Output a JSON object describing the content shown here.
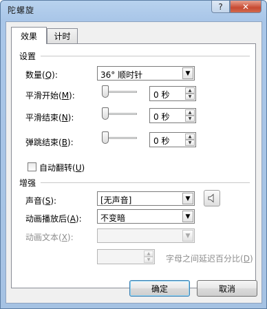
{
  "window": {
    "title": "陀螺旋"
  },
  "titlebar": {
    "help_label": "?",
    "close_label": "✕"
  },
  "tabs": [
    {
      "label": "效果",
      "active": true
    },
    {
      "label": "计时",
      "active": false
    }
  ],
  "settings": {
    "section_title": "设置",
    "amount": {
      "label": "数量(",
      "mnemonic": "Q",
      "suffix": "):",
      "value": "36° 顺时针"
    },
    "smooth_start": {
      "label": "平滑开始(",
      "mnemonic": "M",
      "suffix": "):",
      "slider_fraction": 0.0,
      "value": "0 秒"
    },
    "smooth_end": {
      "label": "平滑结束(",
      "mnemonic": "N",
      "suffix": "):",
      "slider_fraction": 0.0,
      "value": "0 秒"
    },
    "bounce_end": {
      "label": "弹跳结束(",
      "mnemonic": "B",
      "suffix": "):",
      "slider_fraction": 0.0,
      "value": "0 秒"
    },
    "auto_reverse": {
      "label": "自动翻转(",
      "mnemonic": "U",
      "suffix": ")",
      "checked": false
    }
  },
  "enhancements": {
    "section_title": "增强",
    "sound": {
      "label": "声音(",
      "mnemonic": "S",
      "suffix": "):",
      "value": "[无声音]"
    },
    "after_animation": {
      "label": "动画播放后(",
      "mnemonic": "A",
      "suffix": "):",
      "value": "不变暗"
    },
    "animate_text": {
      "label": "动画文本(",
      "mnemonic": "X",
      "suffix": "):",
      "value": ""
    },
    "delay_between": {
      "value": "",
      "label": "字母之间延迟百分比(",
      "mnemonic": "D",
      "suffix": ")"
    }
  },
  "footer": {
    "ok_label": "确定",
    "cancel_label": "取消"
  }
}
